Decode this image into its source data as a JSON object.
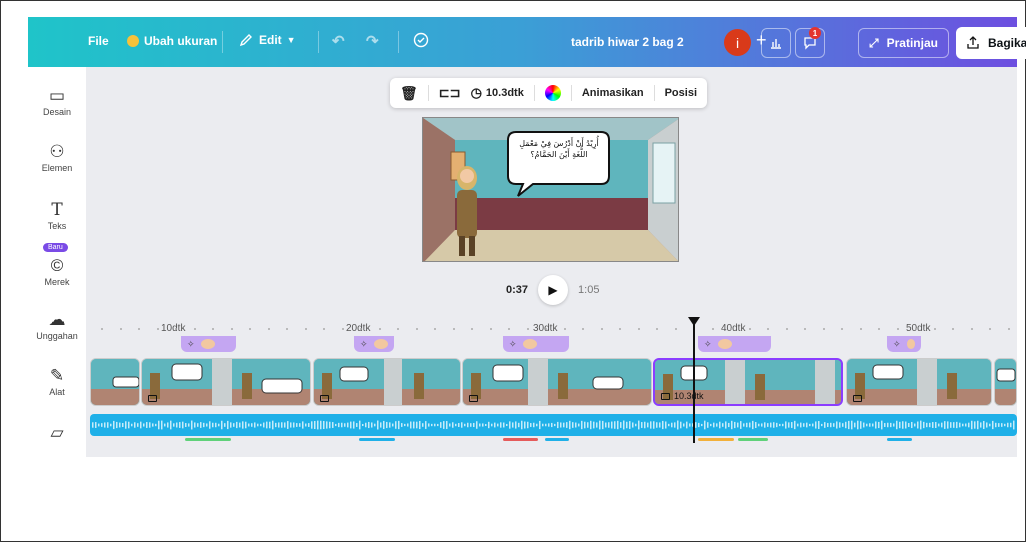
{
  "topbar": {
    "file_label": "File",
    "resize_label": "Ubah ukuran",
    "edit_label": "Edit",
    "doc_title": "tadrib hiwar 2 bag 2",
    "avatar_initial": "i",
    "comments_count": "1",
    "preview_label": "Pratinjau",
    "share_label": "Bagikan"
  },
  "sidebar": {
    "items": [
      {
        "label": "Desain",
        "icon": "design-icon"
      },
      {
        "label": "Elemen",
        "icon": "elements-icon"
      },
      {
        "label": "Teks",
        "icon": "text-icon"
      },
      {
        "label": "Merek",
        "icon": "brand-icon"
      },
      {
        "label": "Unggahan",
        "icon": "upload-icon"
      },
      {
        "label": "Alat",
        "icon": "tools-icon"
      }
    ],
    "new_badge": "Baru"
  },
  "context_toolbar": {
    "duration": "10.3dtk",
    "animate_label": "Animasikan",
    "position_label": "Posisi"
  },
  "slide": {
    "bubble_text": "أُرِيْدُ أَنْ أَدْرُسَ فِيْ مَعْمَلِ اللُّغَةِ أَيْنَ الحَمَّامُ؟"
  },
  "playback": {
    "current": "0:37",
    "total": "1:05"
  },
  "timeline": {
    "ruler": [
      "10dtk",
      "20dtk",
      "30dtk",
      "40dtk",
      "50dtk"
    ],
    "selected_clip_duration": "10.3dtk"
  },
  "colors": {
    "accent": "#8b3dff",
    "audio": "#1fb0e8",
    "anim": "#c4a6f2"
  }
}
